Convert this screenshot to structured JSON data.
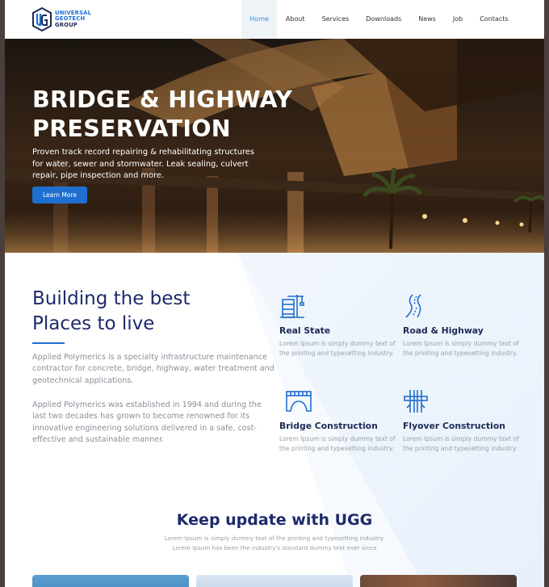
{
  "brand": {
    "line1": "UNIVERSAL",
    "line2": "GEOTECH",
    "line3": "GROUP",
    "colors": {
      "primary": "#1f6fd0",
      "dark": "#1d2a6b"
    }
  },
  "nav": {
    "items": [
      {
        "label": "Home",
        "active": true
      },
      {
        "label": "About"
      },
      {
        "label": "Services"
      },
      {
        "label": "Downloads"
      },
      {
        "label": "News"
      },
      {
        "label": "Job"
      },
      {
        "label": "Contacts"
      }
    ]
  },
  "hero": {
    "title": "BRIDGE & HIGHWAY PRESERVATION",
    "description": "Proven track record repairing & rehabilitating structures for water, sewer and stormwater. Leak sealing, culvert repair, pipe inspection and more.",
    "button": "Learn More"
  },
  "building": {
    "title": "Building the best Places to live",
    "p1": "Applied Polymerics is a specialty infrastructure maintenance contractor for concrete, bridge, highway, water treatment and geotechnical applications.",
    "p2": "Applied Polymerics was established in 1994 and during the last two decades has grown to become renowned for its innovative engineering solutions delivered in a safe, cost-effective and sustainable manner."
  },
  "features": [
    {
      "icon": "building-crane-icon",
      "title": "Real State",
      "desc": "Lorem Ipsum is simply dummy text of the printing and typesetting industry."
    },
    {
      "icon": "road-icon",
      "title": "Road & Highway",
      "desc": "Lorem Ipsum is simply dummy text of the printing and typesetting industry."
    },
    {
      "icon": "bridge-icon",
      "title": "Bridge Construction",
      "desc": "Lorem Ipsum is simply dummy text of the printing and typesetting industry."
    },
    {
      "icon": "flyover-icon",
      "title": "Flyover Construction",
      "desc": "Lorem Ipsum is simply dummy text of the printing and typesetting industry."
    }
  ],
  "update": {
    "title": "Keep update with UGG",
    "line1": "Lorem Ipsum is simply dummy text of the printing and typesetting industry.",
    "line2": "Lorem Ipsum has been the industry's standard dummy text ever since"
  }
}
